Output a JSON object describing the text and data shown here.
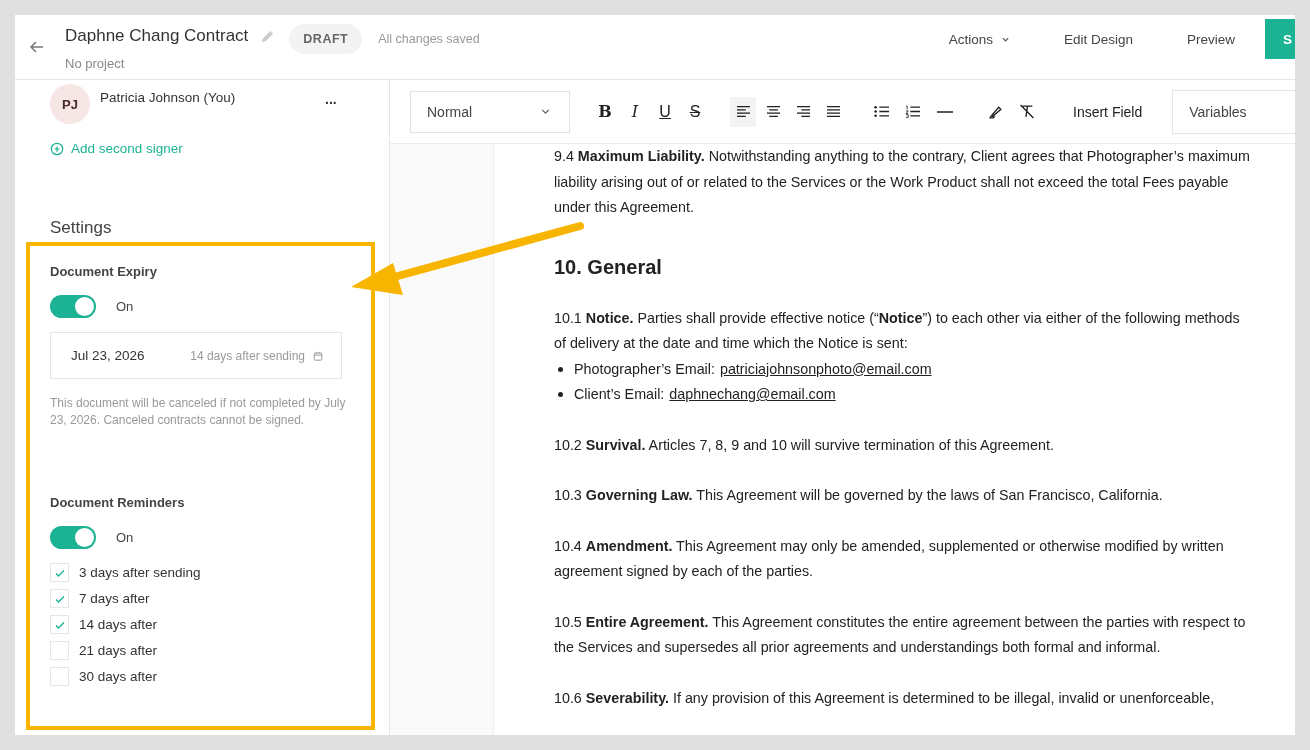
{
  "header": {
    "title": "Daphne Chang Contract",
    "project": "No project",
    "status": "DRAFT",
    "save_state": "All changes saved",
    "actions": [
      {
        "label": "Actions",
        "kind": "dropdown"
      },
      {
        "label": "Edit Design",
        "kind": "plain"
      },
      {
        "label": "Preview",
        "kind": "plain"
      },
      {
        "label": "S",
        "kind": "primary"
      }
    ]
  },
  "sidebar": {
    "signer": {
      "initials": "PJ",
      "name": "Patricia Johnson (You)",
      "menu": "..."
    },
    "add_signer": "Add second signer",
    "settings_title": "Settings",
    "expiry": {
      "title": "Document Expiry",
      "on": true,
      "state_label": "On",
      "date": "Jul 23, 2026",
      "relative": "14 days after sending",
      "note": "This document will be canceled if not completed by July 23, 2026. Canceled contracts cannot be signed."
    },
    "reminders": {
      "title": "Document Reminders",
      "on": true,
      "state_label": "On",
      "options": [
        {
          "label": "3 days after sending",
          "checked": true
        },
        {
          "label": "7 days after",
          "checked": true
        },
        {
          "label": "14 days after",
          "checked": true
        },
        {
          "label": "21 days after",
          "checked": false
        },
        {
          "label": "30 days after",
          "checked": false
        }
      ]
    }
  },
  "toolbar": {
    "style": "Normal",
    "marks": [
      {
        "label": "B",
        "kind": "bold"
      },
      {
        "label": "I",
        "kind": "italic"
      },
      {
        "label": "U",
        "kind": "underline"
      },
      {
        "label": "S",
        "kind": "strike"
      }
    ],
    "align": [
      {
        "kind": "left",
        "selected": true
      },
      {
        "kind": "center",
        "selected": false
      },
      {
        "kind": "right",
        "selected": false
      },
      {
        "kind": "justify",
        "selected": false
      }
    ],
    "insert_field": "Insert Field",
    "variables": "Variables"
  },
  "document": [
    {
      "kind": "para",
      "text": "9.4 **Maximum Liability.** Notwithstanding anything to the contrary, Client agrees that Photographer’s maximum liability arising out of or related to the Services or the Work Product shall not exceed the total Fees payable under this Agreement."
    },
    {
      "kind": "heading",
      "text": "10. General"
    },
    {
      "kind": "para",
      "text": "10.1 **Notice.** Parties shall provide effective notice (“**Notice**”) to each other via either of the following methods of delivery at the date and time which the Notice is sent:"
    },
    {
      "kind": "bullet",
      "label": "Photographer’s Email:",
      "link": "patriciajohnsonphoto@email.com"
    },
    {
      "kind": "bullet",
      "label": "Client’s Email:",
      "link": "daphnechang@email.com"
    },
    {
      "kind": "para",
      "text": "10.2 **Survival.** Articles 7, 8, 9 and 10 will survive termination of this Agreement."
    },
    {
      "kind": "para",
      "text": "10.3 **Governing Law.** This Agreement will be governed by the laws of San Francisco, California."
    },
    {
      "kind": "para",
      "text": "10.4 **Amendment.** This Agreement may only be amended, supplemented or otherwise modified by written agreement signed by each of the parties."
    },
    {
      "kind": "para",
      "text": "10.5 **Entire Agreement.** This Agreement constitutes the entire agreement between the parties with respect to the Services and supersedes all prior agreements and understandings both formal and informal."
    },
    {
      "kind": "para",
      "text": "10.6 **Severability.** If any provision of this Agreement is determined to be illegal, invalid or unenforceable,"
    }
  ]
}
